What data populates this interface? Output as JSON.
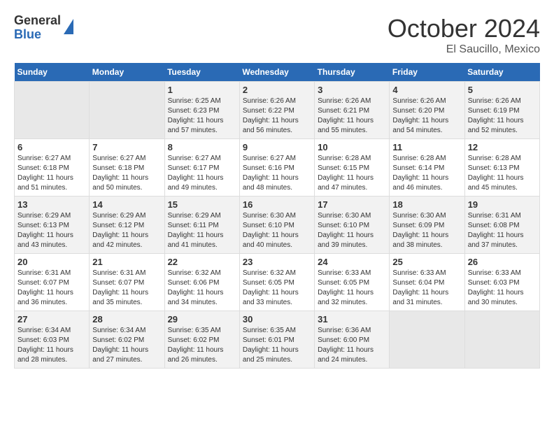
{
  "header": {
    "logo_general": "General",
    "logo_blue": "Blue",
    "month_title": "October 2024",
    "location": "El Saucillo, Mexico"
  },
  "days_of_week": [
    "Sunday",
    "Monday",
    "Tuesday",
    "Wednesday",
    "Thursday",
    "Friday",
    "Saturday"
  ],
  "weeks": [
    [
      {
        "day": "",
        "empty": true
      },
      {
        "day": "",
        "empty": true
      },
      {
        "day": "1",
        "sunrise": "Sunrise: 6:25 AM",
        "sunset": "Sunset: 6:23 PM",
        "daylight": "Daylight: 11 hours and 57 minutes."
      },
      {
        "day": "2",
        "sunrise": "Sunrise: 6:26 AM",
        "sunset": "Sunset: 6:22 PM",
        "daylight": "Daylight: 11 hours and 56 minutes."
      },
      {
        "day": "3",
        "sunrise": "Sunrise: 6:26 AM",
        "sunset": "Sunset: 6:21 PM",
        "daylight": "Daylight: 11 hours and 55 minutes."
      },
      {
        "day": "4",
        "sunrise": "Sunrise: 6:26 AM",
        "sunset": "Sunset: 6:20 PM",
        "daylight": "Daylight: 11 hours and 54 minutes."
      },
      {
        "day": "5",
        "sunrise": "Sunrise: 6:26 AM",
        "sunset": "Sunset: 6:19 PM",
        "daylight": "Daylight: 11 hours and 52 minutes."
      }
    ],
    [
      {
        "day": "6",
        "sunrise": "Sunrise: 6:27 AM",
        "sunset": "Sunset: 6:18 PM",
        "daylight": "Daylight: 11 hours and 51 minutes."
      },
      {
        "day": "7",
        "sunrise": "Sunrise: 6:27 AM",
        "sunset": "Sunset: 6:18 PM",
        "daylight": "Daylight: 11 hours and 50 minutes."
      },
      {
        "day": "8",
        "sunrise": "Sunrise: 6:27 AM",
        "sunset": "Sunset: 6:17 PM",
        "daylight": "Daylight: 11 hours and 49 minutes."
      },
      {
        "day": "9",
        "sunrise": "Sunrise: 6:27 AM",
        "sunset": "Sunset: 6:16 PM",
        "daylight": "Daylight: 11 hours and 48 minutes."
      },
      {
        "day": "10",
        "sunrise": "Sunrise: 6:28 AM",
        "sunset": "Sunset: 6:15 PM",
        "daylight": "Daylight: 11 hours and 47 minutes."
      },
      {
        "day": "11",
        "sunrise": "Sunrise: 6:28 AM",
        "sunset": "Sunset: 6:14 PM",
        "daylight": "Daylight: 11 hours and 46 minutes."
      },
      {
        "day": "12",
        "sunrise": "Sunrise: 6:28 AM",
        "sunset": "Sunset: 6:13 PM",
        "daylight": "Daylight: 11 hours and 45 minutes."
      }
    ],
    [
      {
        "day": "13",
        "sunrise": "Sunrise: 6:29 AM",
        "sunset": "Sunset: 6:13 PM",
        "daylight": "Daylight: 11 hours and 43 minutes."
      },
      {
        "day": "14",
        "sunrise": "Sunrise: 6:29 AM",
        "sunset": "Sunset: 6:12 PM",
        "daylight": "Daylight: 11 hours and 42 minutes."
      },
      {
        "day": "15",
        "sunrise": "Sunrise: 6:29 AM",
        "sunset": "Sunset: 6:11 PM",
        "daylight": "Daylight: 11 hours and 41 minutes."
      },
      {
        "day": "16",
        "sunrise": "Sunrise: 6:30 AM",
        "sunset": "Sunset: 6:10 PM",
        "daylight": "Daylight: 11 hours and 40 minutes."
      },
      {
        "day": "17",
        "sunrise": "Sunrise: 6:30 AM",
        "sunset": "Sunset: 6:10 PM",
        "daylight": "Daylight: 11 hours and 39 minutes."
      },
      {
        "day": "18",
        "sunrise": "Sunrise: 6:30 AM",
        "sunset": "Sunset: 6:09 PM",
        "daylight": "Daylight: 11 hours and 38 minutes."
      },
      {
        "day": "19",
        "sunrise": "Sunrise: 6:31 AM",
        "sunset": "Sunset: 6:08 PM",
        "daylight": "Daylight: 11 hours and 37 minutes."
      }
    ],
    [
      {
        "day": "20",
        "sunrise": "Sunrise: 6:31 AM",
        "sunset": "Sunset: 6:07 PM",
        "daylight": "Daylight: 11 hours and 36 minutes."
      },
      {
        "day": "21",
        "sunrise": "Sunrise: 6:31 AM",
        "sunset": "Sunset: 6:07 PM",
        "daylight": "Daylight: 11 hours and 35 minutes."
      },
      {
        "day": "22",
        "sunrise": "Sunrise: 6:32 AM",
        "sunset": "Sunset: 6:06 PM",
        "daylight": "Daylight: 11 hours and 34 minutes."
      },
      {
        "day": "23",
        "sunrise": "Sunrise: 6:32 AM",
        "sunset": "Sunset: 6:05 PM",
        "daylight": "Daylight: 11 hours and 33 minutes."
      },
      {
        "day": "24",
        "sunrise": "Sunrise: 6:33 AM",
        "sunset": "Sunset: 6:05 PM",
        "daylight": "Daylight: 11 hours and 32 minutes."
      },
      {
        "day": "25",
        "sunrise": "Sunrise: 6:33 AM",
        "sunset": "Sunset: 6:04 PM",
        "daylight": "Daylight: 11 hours and 31 minutes."
      },
      {
        "day": "26",
        "sunrise": "Sunrise: 6:33 AM",
        "sunset": "Sunset: 6:03 PM",
        "daylight": "Daylight: 11 hours and 30 minutes."
      }
    ],
    [
      {
        "day": "27",
        "sunrise": "Sunrise: 6:34 AM",
        "sunset": "Sunset: 6:03 PM",
        "daylight": "Daylight: 11 hours and 28 minutes."
      },
      {
        "day": "28",
        "sunrise": "Sunrise: 6:34 AM",
        "sunset": "Sunset: 6:02 PM",
        "daylight": "Daylight: 11 hours and 27 minutes."
      },
      {
        "day": "29",
        "sunrise": "Sunrise: 6:35 AM",
        "sunset": "Sunset: 6:02 PM",
        "daylight": "Daylight: 11 hours and 26 minutes."
      },
      {
        "day": "30",
        "sunrise": "Sunrise: 6:35 AM",
        "sunset": "Sunset: 6:01 PM",
        "daylight": "Daylight: 11 hours and 25 minutes."
      },
      {
        "day": "31",
        "sunrise": "Sunrise: 6:36 AM",
        "sunset": "Sunset: 6:00 PM",
        "daylight": "Daylight: 11 hours and 24 minutes."
      },
      {
        "day": "",
        "empty": true
      },
      {
        "day": "",
        "empty": true
      }
    ]
  ]
}
